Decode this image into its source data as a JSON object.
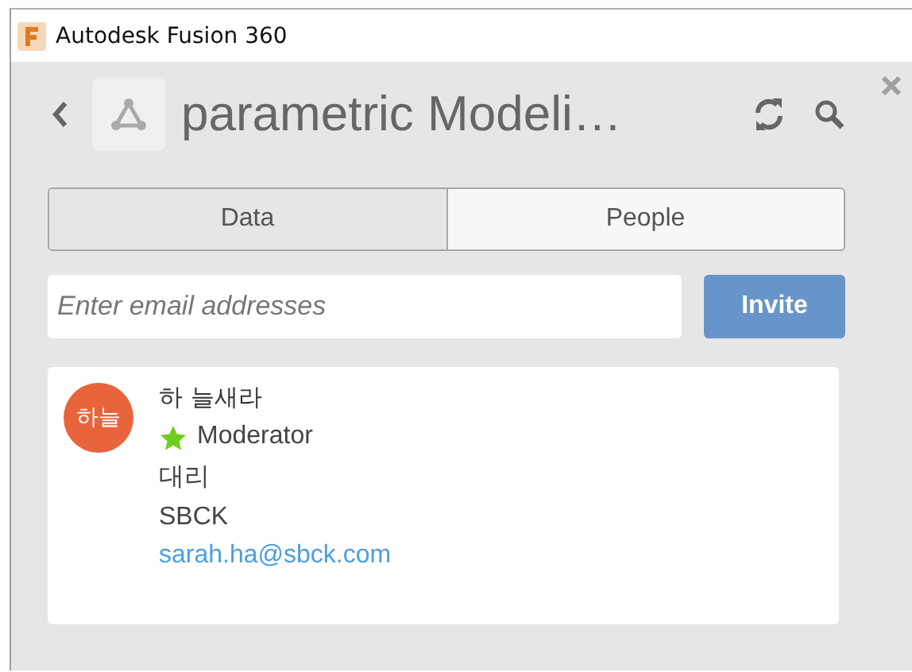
{
  "window": {
    "title": "Autodesk Fusion 360"
  },
  "header": {
    "project": "parametric Modeli…"
  },
  "tabs": [
    {
      "label": "Data",
      "selected": false
    },
    {
      "label": "People",
      "selected": true
    }
  ],
  "invite": {
    "placeholder": "Enter email addresses",
    "button": "Invite"
  },
  "members": [
    {
      "avatar": "하늘",
      "color": "#e8643c",
      "name": "하 늘새라",
      "role": "Moderator",
      "title": "대리",
      "company": "SBCK",
      "email": "sarah.ha@sbck.com"
    }
  ]
}
